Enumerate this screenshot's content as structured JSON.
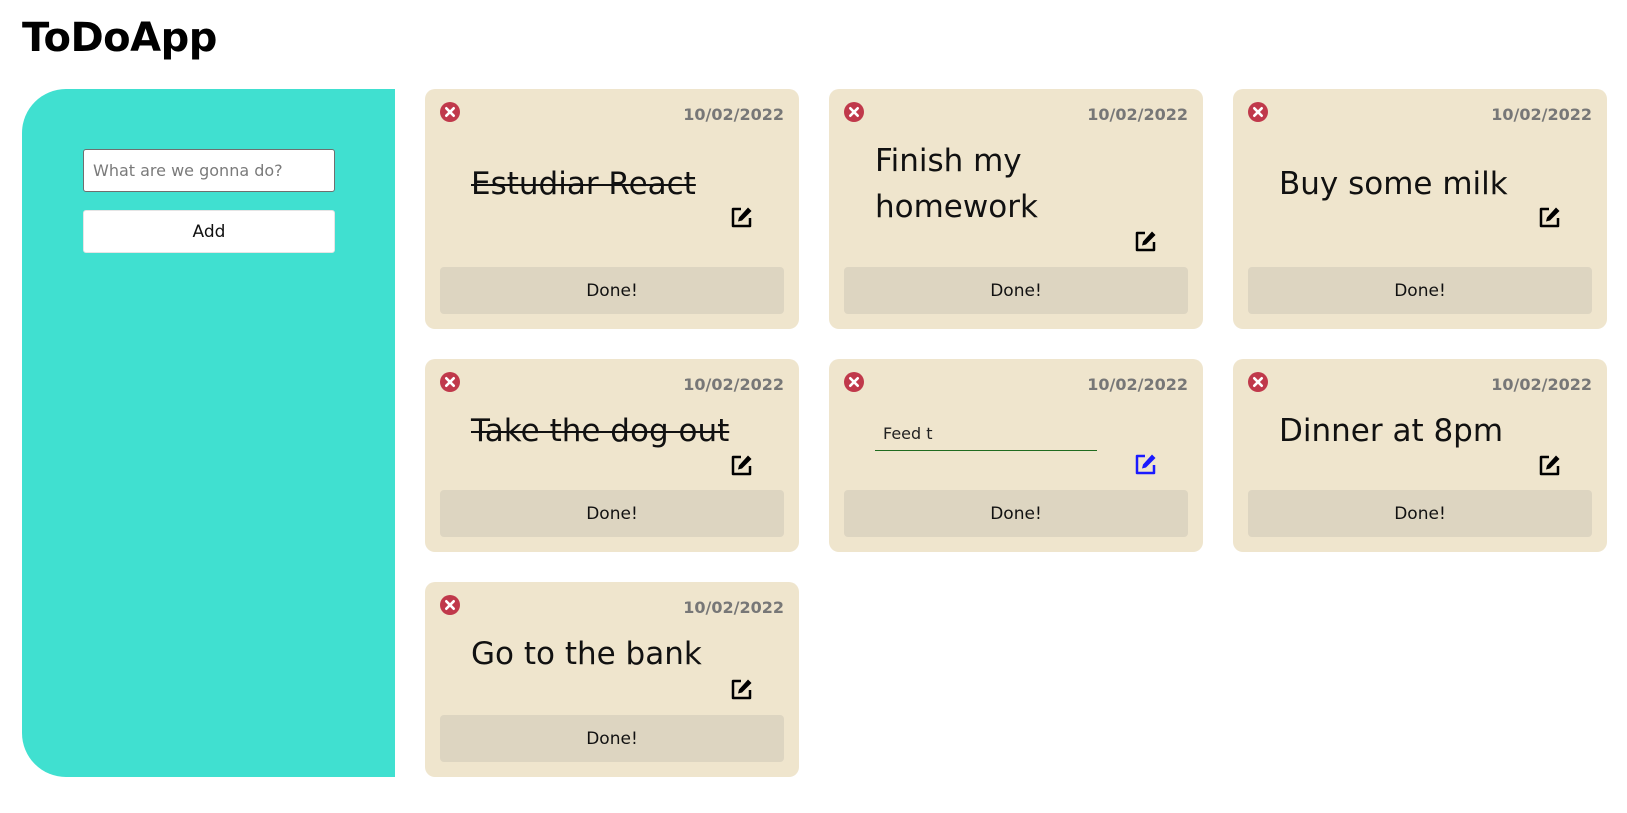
{
  "app": {
    "title": "ToDoApp"
  },
  "sidebar": {
    "input_placeholder": "What are we gonna do?",
    "input_value": "",
    "add_label": "Add"
  },
  "colors": {
    "sidebar": "#40e0d0",
    "card": "#efe5cd",
    "done_button": "#ddd5c1",
    "delete_icon": "#c0394b",
    "active_edit_icon": "#1a1aff",
    "date_text": "#777777"
  },
  "tasks": [
    {
      "date": "10/02/2022",
      "text": "Estudiar React",
      "completed": true,
      "editing": false,
      "done_label": "Done!",
      "delete_icon": "close-circle-icon",
      "edit_icon": "edit-icon"
    },
    {
      "date": "10/02/2022",
      "text": "Finish my homework",
      "completed": false,
      "editing": false,
      "done_label": "Done!",
      "delete_icon": "close-circle-icon",
      "edit_icon": "edit-icon"
    },
    {
      "date": "10/02/2022",
      "text": "Buy some milk",
      "completed": false,
      "editing": false,
      "done_label": "Done!",
      "delete_icon": "close-circle-icon",
      "edit_icon": "edit-icon"
    },
    {
      "date": "10/02/2022",
      "text": "Take the dog out",
      "completed": true,
      "editing": false,
      "done_label": "Done!",
      "delete_icon": "close-circle-icon",
      "edit_icon": "edit-icon"
    },
    {
      "date": "10/02/2022",
      "text": "",
      "edit_value": "Feed t",
      "completed": false,
      "editing": true,
      "done_label": "Done!",
      "delete_icon": "close-circle-icon",
      "edit_icon": "edit-icon"
    },
    {
      "date": "10/02/2022",
      "text": "Dinner at 8pm",
      "completed": false,
      "editing": false,
      "done_label": "Done!",
      "delete_icon": "close-circle-icon",
      "edit_icon": "edit-icon"
    },
    {
      "date": "10/02/2022",
      "text": "Go to the bank",
      "completed": false,
      "editing": false,
      "done_label": "Done!",
      "delete_icon": "close-circle-icon",
      "edit_icon": "edit-icon"
    }
  ]
}
